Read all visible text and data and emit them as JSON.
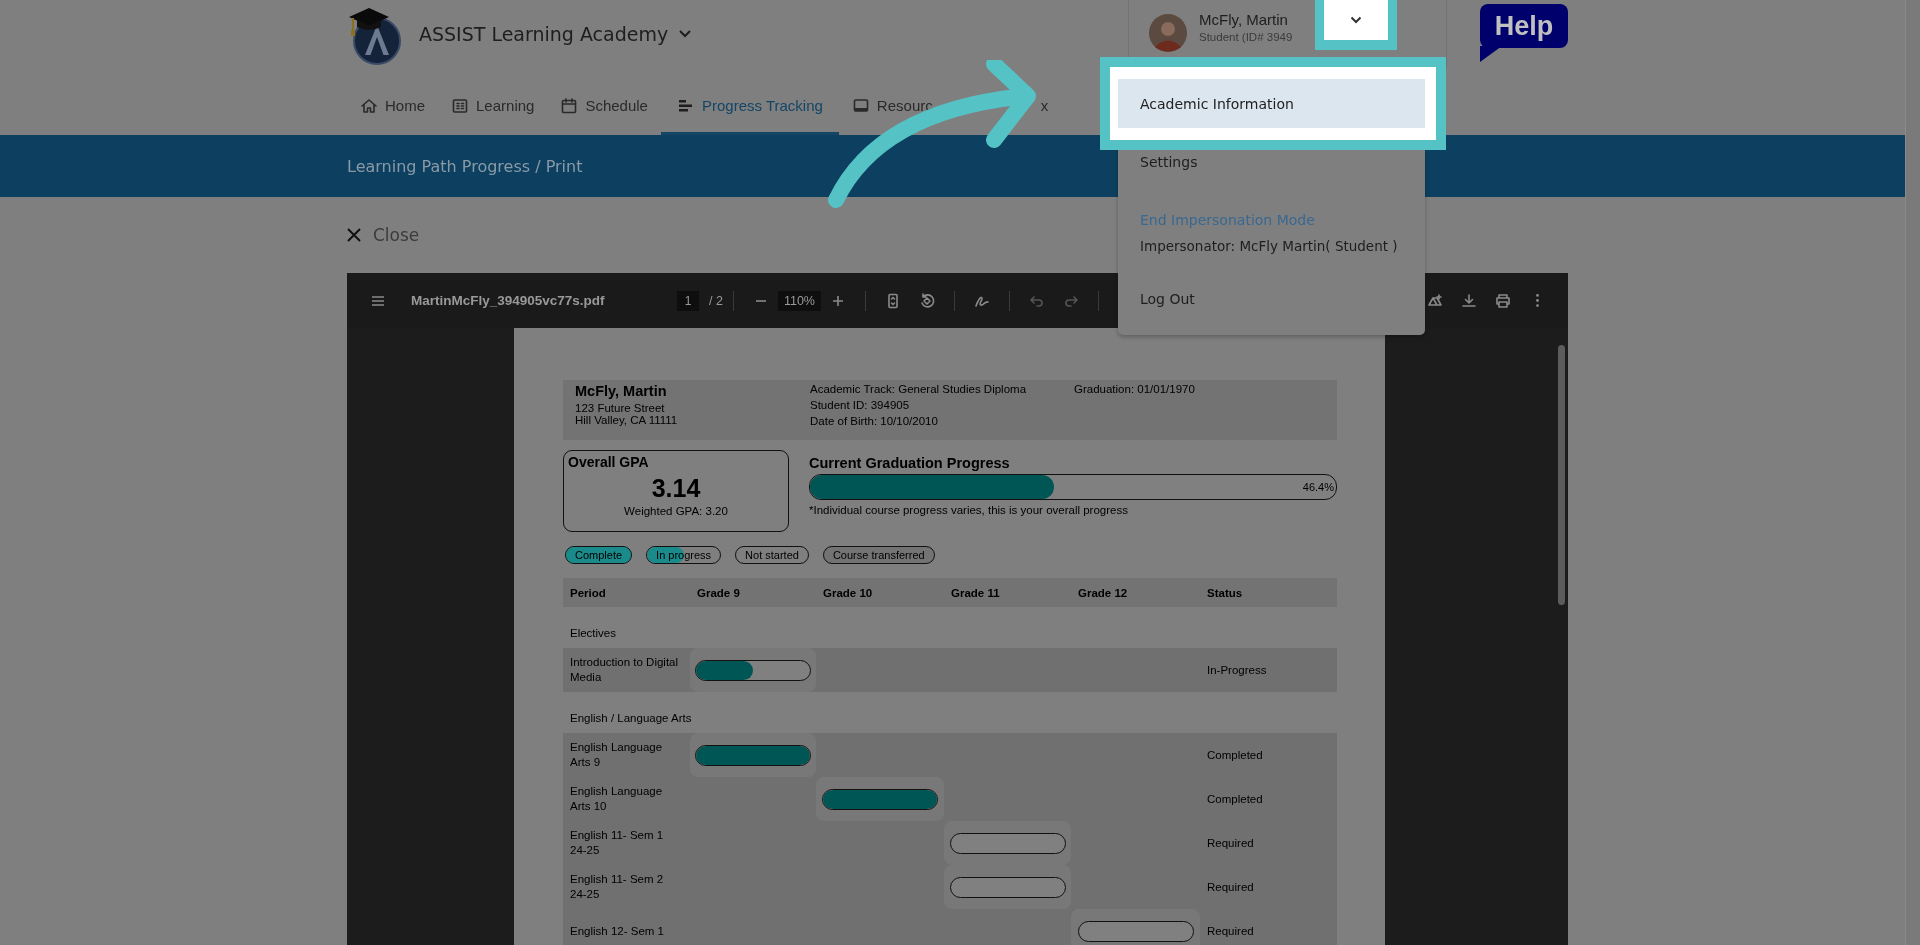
{
  "header": {
    "school": "ASSIST Learning Academy",
    "user": {
      "name": "McFly, Martin",
      "subtitle": "Student (ID# 3949"
    },
    "help": "Help"
  },
  "nav_tabs": [
    {
      "label": "Home",
      "kind": "home",
      "selected": false
    },
    {
      "label": "Learning",
      "kind": "learning",
      "selected": false
    },
    {
      "label": "Schedule",
      "kind": "calendar",
      "selected": false
    },
    {
      "label": "Progress Tracking",
      "kind": "progress",
      "selected": true
    },
    {
      "label": "Resourc",
      "kind": "resources",
      "selected": false
    },
    {
      "label": "x",
      "kind": "plain",
      "selected": false
    }
  ],
  "banner": "Learning Path Progress / Print",
  "close": "Close",
  "pdf_viewer": {
    "filename": "MartinMcFly_394905vc77s.pdf",
    "page": "1",
    "page_total": "/ 2",
    "zoom": "110%",
    "document": {
      "student_name": "McFly, Martin",
      "address": [
        "123 Future Street",
        "Hill Valley, CA 11111"
      ],
      "details": [
        "Academic Track: General Studies Diploma",
        "Student ID: 394905",
        "Date of Birth: 10/10/2010"
      ],
      "graduation": "Graduation: 01/01/1970",
      "gpa": {
        "title": "Overall GPA",
        "value": "3.14",
        "weighted": "Weighted GPA: 3.20"
      },
      "progress": {
        "title": "Current Graduation Progress",
        "level": 0.464,
        "reading": "46.4%",
        "note": "*Individual course progress varies, this is your overall progress"
      },
      "legend": [
        {
          "label": "Complete",
          "kind": "complete"
        },
        {
          "label": "In progress",
          "kind": "in_progress"
        },
        {
          "label": "Not started",
          "kind": "not_started"
        },
        {
          "label": "Course transferred",
          "kind": "transferred"
        }
      ],
      "columns": [
        "Period",
        "Grade 9",
        "Grade 10",
        "Grade 11",
        "Grade 12",
        "Status"
      ],
      "sections": [
        {
          "title": "Electives",
          "courses": [
            {
              "name": "Introduction to Digital Media",
              "cells": [
                {
                  "bar": true,
                  "level": 0.5
                },
                {
                  "bar": false
                },
                {
                  "bar": false
                },
                {
                  "bar": false
                }
              ],
              "status": "In-Progress"
            }
          ]
        },
        {
          "title": "English / Language Arts",
          "courses": [
            {
              "name": "English Language Arts 9",
              "cells": [
                {
                  "bar": true,
                  "level": 1
                },
                {
                  "bar": false
                },
                {
                  "bar": false
                },
                {
                  "bar": false
                }
              ],
              "status": "Completed"
            },
            {
              "name": "English Language Arts 10",
              "cells": [
                {
                  "bar": false
                },
                {
                  "bar": true,
                  "level": 1
                },
                {
                  "bar": false
                },
                {
                  "bar": false
                }
              ],
              "status": "Completed"
            },
            {
              "name": "English 11- Sem 1 24-25",
              "cells": [
                {
                  "bar": false
                },
                {
                  "bar": false
                },
                {
                  "bar": true,
                  "level": 0
                },
                {
                  "bar": false
                }
              ],
              "status": "Required"
            },
            {
              "name": "English 11- Sem 2 24-25",
              "cells": [
                {
                  "bar": false
                },
                {
                  "bar": false
                },
                {
                  "bar": true,
                  "level": 0
                },
                {
                  "bar": false
                }
              ],
              "status": "Required"
            },
            {
              "name": "English 12- Sem 1",
              "cells": [
                {
                  "bar": false
                },
                {
                  "bar": false
                },
                {
                  "bar": false
                },
                {
                  "bar": true,
                  "level": 0
                }
              ],
              "status": "Required"
            }
          ]
        }
      ]
    }
  },
  "user_menu": {
    "items": [
      {
        "label": "Academic Information",
        "kind": "item",
        "selected": true
      },
      {
        "label": "Settings",
        "kind": "item",
        "selected": false
      },
      {
        "label": "End Impersonation Mode",
        "kind": "link",
        "selected": false
      },
      {
        "label": "Impersonator: McFly Martin( Student )",
        "kind": "note",
        "selected": false
      },
      {
        "label": "Log Out",
        "kind": "item",
        "selected": false
      }
    ]
  }
}
